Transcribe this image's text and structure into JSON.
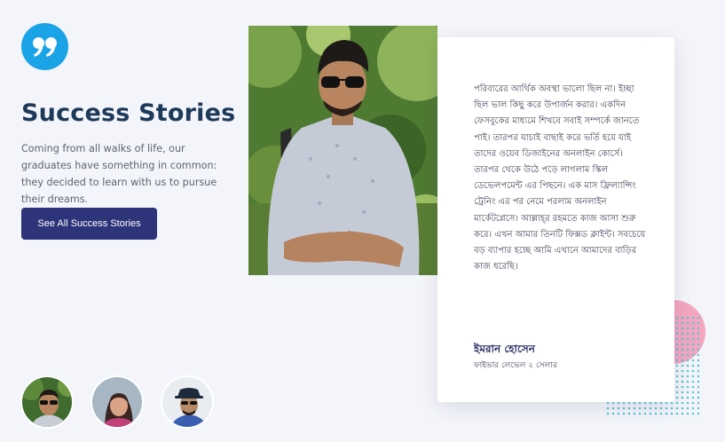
{
  "hero": {
    "title": "Success Stories",
    "description": "Coming from all walks of life, our graduates have something in common: they decided to learn with us to pursue their dreams.",
    "cta_label": "See All Success Stories",
    "quote_icon": "quote-icon"
  },
  "testimonial": {
    "quote": "পরিবারের আর্থিক অবস্থা ভালো ছিল না। ইচ্ছা ছিল ভাল কিছু করে উপার্জন করার। একদিন ফেসবুকের মাধ্যমে শিখবে সবাই সম্পর্কে জানতে পাই। তারপর যাচাই বাছাই করে ভর্তি হয়ে যাই তাদের ওয়েব ডিজাইনের অনলাইন কোর্সে। তারপর থেকে উঠে পড়ে লাগলাম স্কিল ডেভেলপমেন্ট এর পিছনে। এক মাস ফ্রিল্যান্সিং ট্রেনিং এর পর নেমে পরলাম অনলাইন মার্কেটপ্লেসে। আল্লাহ্‌র রহমতে কাজ আসা শুরু করে। এখন আমার তিনটি ফিক্সড ক্লাইন্ট। সবচেয়ে বড় ব্যাপার হচ্ছে আমি এখানে আমাদের বাড়ির কাজ ধরেছি।",
    "author_name": "ইমরান হোসেন",
    "author_role": "ফাইভার লেভেল ২ সেলার"
  },
  "colors": {
    "accent": "#1aa3e6",
    "heading": "#1d3a5a",
    "button": "#2e3479",
    "decor_pink": "#f4a6c0",
    "decor_dots": "#5cc5d6"
  },
  "avatars": [
    {
      "icon": "avatar-man-sunglasses"
    },
    {
      "icon": "avatar-woman"
    },
    {
      "icon": "avatar-man-hat"
    }
  ]
}
